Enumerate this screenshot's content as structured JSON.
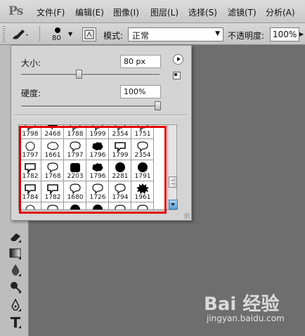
{
  "app": {
    "logo": "Ps"
  },
  "menu": [
    "文件(F)",
    "编辑(E)",
    "图像(I)",
    "图层(L)",
    "选择(S)",
    "滤镜(T)",
    "分析(A)"
  ],
  "options": {
    "brush_size": "80",
    "mode_label": "模式:",
    "mode_value": "正常",
    "opacity_label": "不透明度:",
    "opacity_value": "100%"
  },
  "brush_panel": {
    "size_label": "大小:",
    "size_value": "80 px",
    "size_level": 0.41,
    "hardness_label": "硬度:",
    "hardness_value": "100%",
    "hardness_level": 1.0,
    "brushes": [
      {
        "label": "1798",
        "shape": "speech-outline"
      },
      {
        "label": "2468",
        "shape": "speech-filled"
      },
      {
        "label": "1788",
        "shape": "speech-outline"
      },
      {
        "label": "1999",
        "shape": "speech-outline"
      },
      {
        "label": "2354",
        "shape": "speech-outline"
      },
      {
        "label": "1751",
        "shape": "speech-outline"
      },
      {
        "label": "1797",
        "shape": "circle-outline"
      },
      {
        "label": "1661",
        "shape": "cloud-outline"
      },
      {
        "label": "1797",
        "shape": "speech-outline"
      },
      {
        "label": "1796",
        "shape": "cloud-filled"
      },
      {
        "label": "1799",
        "shape": "rect-outline"
      },
      {
        "label": "2354",
        "shape": "speech-outline"
      },
      {
        "label": "1782",
        "shape": "rect-outline"
      },
      {
        "label": "1768",
        "shape": "speech-outline"
      },
      {
        "label": "2203",
        "shape": "square-filled"
      },
      {
        "label": "1796",
        "shape": "cloud-filled"
      },
      {
        "label": "2281",
        "shape": "circle-filled"
      },
      {
        "label": "1791",
        "shape": "circle-filled"
      },
      {
        "label": "1784",
        "shape": "rect-outline"
      },
      {
        "label": "1782",
        "shape": "rect-outline"
      },
      {
        "label": "1680",
        "shape": "speech-outline"
      },
      {
        "label": "1726",
        "shape": "speech-outline"
      },
      {
        "label": "1794",
        "shape": "speech-outline"
      },
      {
        "label": "1961",
        "shape": "burst-filled"
      },
      {
        "label": "",
        "shape": "circle-outline"
      },
      {
        "label": "",
        "shape": "speech-outline"
      },
      {
        "label": "",
        "shape": "circle-filled"
      },
      {
        "label": "",
        "shape": "circle-filled"
      },
      {
        "label": "",
        "shape": "speech-outline"
      },
      {
        "label": "",
        "shape": "speech-outline"
      }
    ]
  },
  "toolbox": [
    "eraser-tool",
    "gradient-tool",
    "blur-tool",
    "dodge-tool",
    "pen-tool",
    "type-tool"
  ],
  "watermark": {
    "line1": "Bai  经验",
    "line2": "jingyan.baidu.com"
  }
}
